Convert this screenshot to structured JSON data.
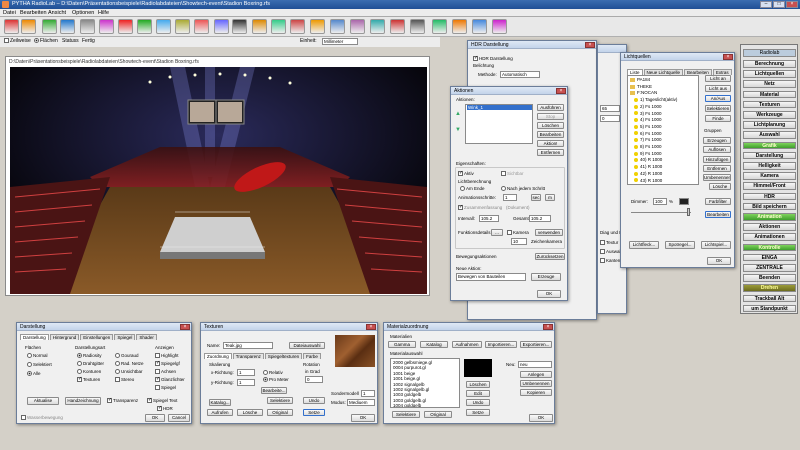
{
  "window": {
    "title": "PYTHA RadioLab – D:\\Daten\\Präsentationsbeispiele\\Radiolabdateien\\Showtech-event\\Stadion Boxring.rfs",
    "min": "–",
    "max": "□",
    "close": "×"
  },
  "menu": [
    "Datei",
    "Bearbeiten",
    "Ansicht",
    "Optionen",
    "Hilfe"
  ],
  "optbar": {
    "zeilweise": "Zeilweise",
    "flaechen": "Flächen",
    "status_label": "Statuss",
    "status_value": "Fertig",
    "einheit_label": "Einheit:",
    "einheit_value": "Millimeter"
  },
  "viewport": {
    "path": "D:\\Daten\\Präsentationsbeispiele\\Radiolabdateien\\Showtech-event\\Stadion Boxring.rfs"
  },
  "hdr_window": {
    "title": "HDR Darstellung",
    "check_label": "HDR Darstellung",
    "belichtung": "Belichtung",
    "methode_label": "Methode:",
    "methode_value": "Automatisch"
  },
  "aktionen": {
    "title": "Aktionen",
    "section": "Aktionen:",
    "item": "Wink_1",
    "btn_ausfuehren": "Ausführen",
    "btn_stop": "Stop",
    "btn_loeschen": "Löschen",
    "btn_bearbeiten": "Bearbeiten",
    "btn_aktiv": "Aktion!",
    "btn_entfernen": "Entfernen",
    "eigenschaften": "Eigenschaften:",
    "aktiv_label": "Aktiv",
    "sichtbar": "Sichtbar",
    "lichtberechnung": "Lichtberechnung",
    "am_ende": "Am Ende",
    "nach_jedem": "Nach jedem Schritt",
    "animationsschritte": "Animationsschritte:",
    "schritte_val": "1",
    "verwendung": "Zusammenfassung",
    "dokument": "(Dokument)",
    "intervall_label": "Intervall:",
    "intervall_val": "105.2",
    "gesamt_label": "Gesamt:",
    "gesamt_val": "105.2",
    "funktion_label": "Funktionsdetails",
    "kamera_label": "Kamera",
    "verwenden": "verwenden",
    "zeichenkamera": "Zeichenkamera",
    "zahl": "10",
    "bewegung": "Bewegungsaktionen",
    "zuruecksetzen": "Zurücksetzen",
    "neue_aktion": "Neue Aktion:",
    "neue_value": "Bewegen von Bauteilen",
    "erzeuge": "Erzeuge",
    "ok": "OK"
  },
  "mid_partial": {
    "val1": "65",
    "val2": "0",
    "diag": "Diag und Ka",
    "textur": "Textur",
    "auswahl": "Auswahl",
    "kanten": "Kanten"
  },
  "lichtquellen": {
    "title": "Lichtquellen",
    "tabs": [
      "Liste",
      "Neue Lichtquelle",
      "Bearbeiten",
      "Extras"
    ],
    "tree": [
      {
        "type": "folder",
        "label": "PA184"
      },
      {
        "type": "folder",
        "label": "THEKE"
      },
      {
        "type": "folder",
        "label": "F:NOCAN"
      },
      {
        "type": "bulb",
        "label": "1) Tageslicht(aktiv)"
      },
      {
        "type": "bulb",
        "label": "2) Fs  1000"
      },
      {
        "type": "bulb",
        "label": "3) Fs  1000"
      },
      {
        "type": "bulb",
        "label": "4) Fs  1000"
      },
      {
        "type": "bulb",
        "label": "5) Fs  1000"
      },
      {
        "type": "bulb",
        "label": "6) Fs  1000"
      },
      {
        "type": "bulb",
        "label": "7) Fs  1000"
      },
      {
        "type": "bulb",
        "label": "8) Fs  1000"
      },
      {
        "type": "bulb",
        "label": "9) Fs  1000"
      },
      {
        "type": "bulb",
        "label": "40) R  1000"
      },
      {
        "type": "bulb",
        "label": "41) R  1000"
      },
      {
        "type": "bulb",
        "label": "42) R  1000"
      },
      {
        "type": "bulb",
        "label": "43) R  1000"
      }
    ],
    "buttons": [
      "Licht an",
      "Licht aus",
      "An/Aus",
      "Selektieren",
      "Finde"
    ],
    "gruppen": "Gruppen",
    "gbuttons": [
      "Erzeugen",
      "Auflösen"
    ],
    "mbuttons": [
      "Hinzufügen",
      "Entfernen",
      "Umbenennen"
    ],
    "loesche": "Lösche",
    "dimmer_label": "Dimmer:",
    "dimmer_val": "100",
    "dimmer_unit": "%",
    "farbfilter": "Farbfilter",
    "bearbeiten": "Bearbeiten",
    "btm_buttons": [
      "Lichtfleck...",
      "Spotregel...",
      "Lichtspiel..."
    ],
    "ok": "OK"
  },
  "sidebar": {
    "header": "Radiolab",
    "items": [
      {
        "label": "Berechnung",
        "style": "plain"
      },
      {
        "label": "Lichtquellen",
        "style": "plain"
      },
      {
        "label": "Netz",
        "style": "plain"
      },
      {
        "label": "Material",
        "style": "plain"
      },
      {
        "label": "Texturen",
        "style": "plain"
      },
      {
        "label": "Werkzeuge",
        "style": "plain"
      },
      {
        "label": "Lichtplanung",
        "style": "plain"
      },
      {
        "label": "Auswahl",
        "style": "plain"
      },
      {
        "label": "Grafik",
        "style": "green"
      },
      {
        "label": "Darstellung",
        "style": "plain"
      },
      {
        "label": "Helligkeit",
        "style": "plain"
      },
      {
        "label": "Kamera",
        "style": "plain"
      },
      {
        "label": "Himmel/Front",
        "style": "plain"
      },
      {
        "label": "HDR",
        "style": "plain"
      },
      {
        "label": "Bild speichern",
        "style": "plain"
      },
      {
        "label": "Animation",
        "style": "green"
      },
      {
        "label": "Aktionen",
        "style": "plain"
      },
      {
        "label": "Animationen",
        "style": "plain"
      },
      {
        "label": "Kontrolle",
        "style": "green"
      },
      {
        "label": "EINGA",
        "style": "plain"
      },
      {
        "label": "ZENTRALE",
        "style": "plain"
      },
      {
        "label": "Beenden",
        "style": "plain"
      },
      {
        "label": "Drehen",
        "style": "olive"
      },
      {
        "label": "Trackball Alt",
        "style": "plain"
      },
      {
        "label": "um Standpunkt",
        "style": "plain"
      }
    ]
  },
  "darstellung": {
    "title": "Darstellung",
    "tabs": [
      "Darstellung",
      "Hintergrund",
      "Einstellungen",
      "Spiegel",
      "Shader"
    ],
    "flaechen": "Flächen",
    "dart": "Darstellungsart",
    "anzeigen": "Anzeigen",
    "col1": [
      "Normal",
      "Selektiert",
      "Alle"
    ],
    "col2": [
      "Radiosity",
      "Drahtgitter",
      "Konturen",
      "Texturen"
    ],
    "col2b": [
      "Gouraud",
      "Rad. Netze",
      "Unsichtbar",
      "Stereo"
    ],
    "col3": [
      "Highlight",
      "Spiegelgf",
      "Achsen",
      "Glanzlichter",
      "Spiegel"
    ],
    "btn_aktualise": "Aktualise",
    "btn_hand": "Handzeichnung",
    "transparenz": "Transparenz",
    "spiegel_text": "Spiegel Text",
    "hdr": "HDR",
    "wasser": "Wasserbewegung",
    "ok": "OK",
    "cancel": "Cancel"
  },
  "texturen": {
    "title": "Texturen",
    "name_label": "Name:",
    "name_val": "Teak.jpg",
    "dateiauswahl": "Dateiauswahl",
    "tabs": [
      "Zuordnung",
      "Transparenz",
      "Spiegeltexturen",
      "Farbe"
    ],
    "skalierung": "Skalierung",
    "x_richtung": "x-Richtung:",
    "x_val": "1",
    "y_richtung": "y-Richtung:",
    "y_val": "1",
    "relativ": "Relativ",
    "pro_meter": "Pro Meter",
    "rotation": "Rotation",
    "in_grad": "in Grad",
    "rot_val": "0",
    "bearbeiten": "Bearbeite...",
    "katalog": "Katalog...",
    "selektiere": "Selektiere",
    "aufrufen": "Aufrufen",
    "loesche": "Lösche",
    "original": "Original",
    "setze": "Setze",
    "sondermodell": "Sondermodell",
    "modus": "Modus:",
    "modus_val": "Mediuem",
    "ok": "OK"
  },
  "material": {
    "title": "Materialzuordnung",
    "materialien": "Materialien",
    "btns_top": [
      "Gamma",
      "Katalog",
      "Aufnahmen",
      "Importieren...",
      "Exportieren..."
    ],
    "materialauswahl": "Materialauswahl",
    "list": [
      "2000 gelbsmiege.gl",
      "0004 purpurot.gl",
      "1001 beige",
      "1001 beige.gl",
      "1002 signalgelb",
      "1002 signalgelb.gl",
      "1003 goldgelb",
      "1003 goldgelb.gl",
      "1004 goldgelb"
    ],
    "neu_label": "Neu:",
    "neu_val": "neu",
    "r_btns": [
      "Anlegen",
      "Umbenennen",
      "Kopieren"
    ],
    "m_btns": [
      "Löschen",
      "Edit",
      "Undo",
      "Setze"
    ],
    "selektiere": "Selektiere",
    "original": "Original",
    "ok": "OK"
  }
}
